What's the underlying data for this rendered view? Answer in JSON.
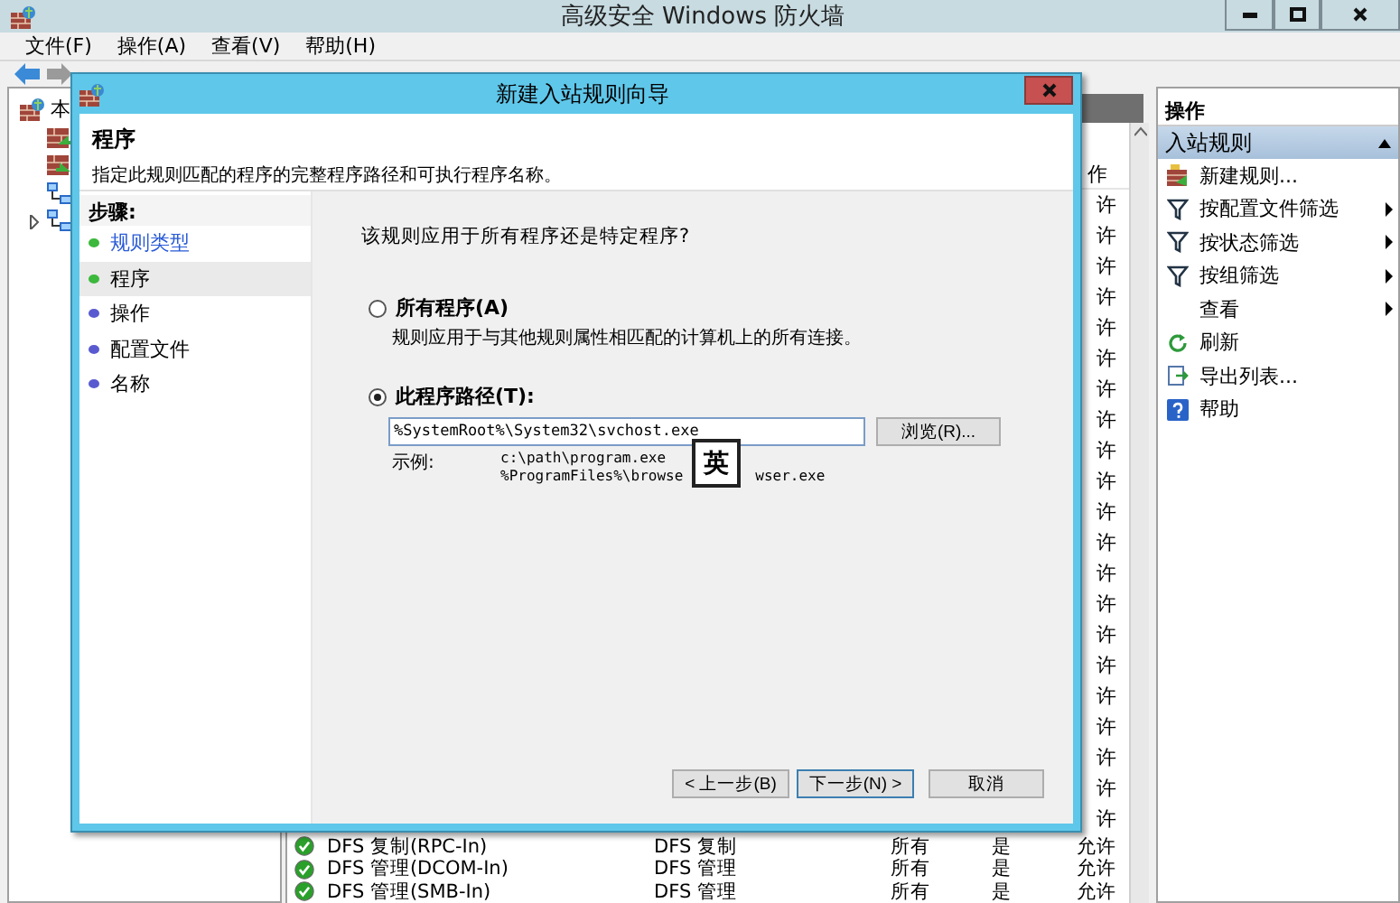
{
  "window": {
    "title": "高级安全 Windows 防火墙"
  },
  "menu": [
    "文件(F)",
    "操作(A)",
    "查看(V)",
    "帮助(H)"
  ],
  "tree": {
    "root": "本",
    "items": [
      {
        "expandable": false
      },
      {
        "expandable": false
      },
      {
        "expandable": false
      },
      {
        "expandable": true
      }
    ]
  },
  "rules": {
    "header": "作",
    "rows": [
      {
        "kind": "partial",
        "action": "许"
      },
      {
        "kind": "partial",
        "action": "许"
      },
      {
        "kind": "partial",
        "action": "许"
      },
      {
        "kind": "partial",
        "action": "许"
      },
      {
        "kind": "partial",
        "action": "许"
      },
      {
        "kind": "partial",
        "action": "许"
      },
      {
        "kind": "partial",
        "action": "许"
      },
      {
        "kind": "partial",
        "action": "许"
      },
      {
        "kind": "partial",
        "action": "许"
      },
      {
        "kind": "partial",
        "action": "许"
      },
      {
        "kind": "partial",
        "action": "许"
      },
      {
        "kind": "partial",
        "action": "许"
      },
      {
        "kind": "partial",
        "action": "许"
      },
      {
        "kind": "partial",
        "action": "许"
      },
      {
        "kind": "partial",
        "action": "许"
      },
      {
        "kind": "partial",
        "action": "许"
      },
      {
        "kind": "partial",
        "action": "许"
      },
      {
        "kind": "partial",
        "action": "许"
      },
      {
        "kind": "partial",
        "action": "许"
      },
      {
        "kind": "partial",
        "action": "许"
      },
      {
        "kind": "partial",
        "action": "许"
      },
      {
        "kind": "full",
        "enabled": true,
        "name": "DFS 复制(RPC-In)",
        "group": "DFS 复制",
        "profile": "所有",
        "enabled_text": "是",
        "action": "允许"
      },
      {
        "kind": "full",
        "enabled": true,
        "name": "DFS 管理(DCOM-In)",
        "group": "DFS 管理",
        "profile": "所有",
        "enabled_text": "是",
        "action": "允许"
      },
      {
        "kind": "full",
        "enabled": true,
        "name": "DFS 管理(SMB-In)",
        "group": "DFS 管理",
        "profile": "所有",
        "enabled_text": "是",
        "action": "允许"
      }
    ]
  },
  "actions": {
    "title": "操作",
    "section": {
      "label": "入站规则",
      "expanded": true
    },
    "items": [
      {
        "kind": "new",
        "label": "新建规则...",
        "submenu": false
      },
      {
        "kind": "filter",
        "label": "按配置文件筛选",
        "submenu": true
      },
      {
        "kind": "filter",
        "label": "按状态筛选",
        "submenu": true
      },
      {
        "kind": "filter",
        "label": "按组筛选",
        "submenu": true
      },
      {
        "kind": "none",
        "label": "查看",
        "submenu": true
      },
      {
        "kind": "refresh",
        "label": "刷新",
        "submenu": false
      },
      {
        "kind": "export",
        "label": "导出列表...",
        "submenu": false
      },
      {
        "kind": "help",
        "label": "帮助",
        "submenu": false
      }
    ]
  },
  "dialog": {
    "title": "新建入站规则向导",
    "heading": "程序",
    "description": "指定此规则匹配的程序的完整程序路径和可执行程序名称。",
    "steps_title": "步骤:",
    "steps": [
      {
        "label": "规则类型",
        "done": true,
        "selected": false
      },
      {
        "label": "程序",
        "done": true,
        "selected": true
      },
      {
        "label": "操作",
        "done": false,
        "selected": false
      },
      {
        "label": "配置文件",
        "done": false,
        "selected": false
      },
      {
        "label": "名称",
        "done": false,
        "selected": false
      }
    ],
    "question": "该规则应用于所有程序还是特定程序?",
    "options": [
      {
        "label": "所有程序(A)",
        "description": "规则应用于与其他规则属性相匹配的计算机上的所有连接。",
        "selected": false
      },
      {
        "label": "此程序路径(T):",
        "selected": true
      }
    ],
    "path": {
      "value": "%SystemRoot%\\System32\\svchost.exe",
      "browse": "浏览(R)..."
    },
    "example": {
      "label": "示例:",
      "line1": "c:\\path\\program.exe",
      "line2_before": "%ProgramFiles%\\browse",
      "line2_after": "wser.exe"
    },
    "ime_indicator": "英",
    "buttons": [
      {
        "label": "< 上一步(B)",
        "default": false
      },
      {
        "label": "下一步(N) >",
        "default": true
      },
      {
        "label": "取消",
        "default": false
      }
    ]
  }
}
